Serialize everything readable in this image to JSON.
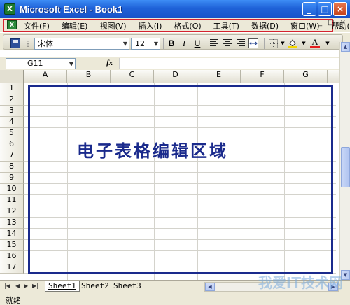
{
  "window": {
    "title": "Microsoft Excel - Book1",
    "app_icon": "X",
    "buttons": {
      "minimize": "_",
      "maximize": "□",
      "close": "×"
    }
  },
  "menu": {
    "doc_icon": "X",
    "items": [
      "文件(F)",
      "编辑(E)",
      "视图(V)",
      "插入(I)",
      "格式(O)",
      "工具(T)",
      "数据(D)",
      "窗口(W)",
      "帮助(H)"
    ],
    "right_controls": [
      "_",
      "□",
      "×"
    ]
  },
  "toolbar": {
    "font": "宋体",
    "size": "12",
    "bold": "B",
    "italic": "I",
    "underline": "U",
    "font_color_label": "A"
  },
  "formula_bar": {
    "name_box": "G11",
    "fx": "fx",
    "formula": ""
  },
  "grid": {
    "columns": [
      "A",
      "B",
      "C",
      "D",
      "E",
      "F",
      "G"
    ],
    "rows": [
      "1",
      "2",
      "3",
      "4",
      "5",
      "6",
      "7",
      "8",
      "9",
      "10",
      "11",
      "12",
      "13",
      "14",
      "15",
      "16",
      "17"
    ],
    "annotation": "电子表格编辑区域"
  },
  "sheets": {
    "tabs": [
      "Sheet1",
      "Sheet2",
      "Sheet3"
    ],
    "active": "Sheet1"
  },
  "status": {
    "text": "就绪"
  },
  "watermark": "我爱IT技术网"
}
